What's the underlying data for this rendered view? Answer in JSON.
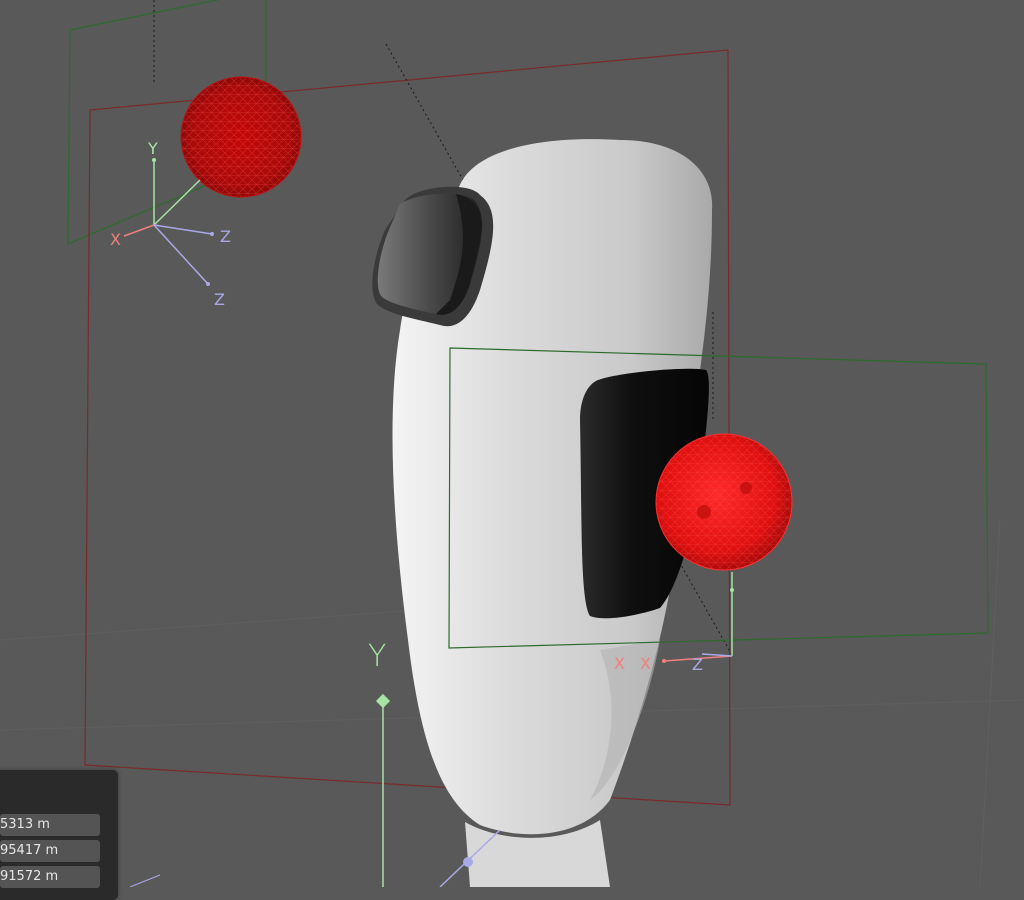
{
  "viewport": {
    "axis_labels": {
      "small_y": "Y",
      "small_z": "Z",
      "small_z2": "Z",
      "small_x": "X",
      "big_y": "Y",
      "right_x1": "X",
      "right_x2": "X",
      "right_z": "Z"
    },
    "colors": {
      "background": "#585958",
      "head": "#d9d9d9",
      "sphere": "#e31010",
      "frame_red": "#7a2a2a",
      "frame_green": "#2d6a2d",
      "axis_y": "#a7e3a3",
      "axis_x": "#f08080",
      "axis_z": "#a9a9e8"
    }
  },
  "properties_panel": {
    "fields": [
      {
        "value": "5313 m"
      },
      {
        "value": "95417 m"
      },
      {
        "value": "91572 m"
      }
    ]
  }
}
